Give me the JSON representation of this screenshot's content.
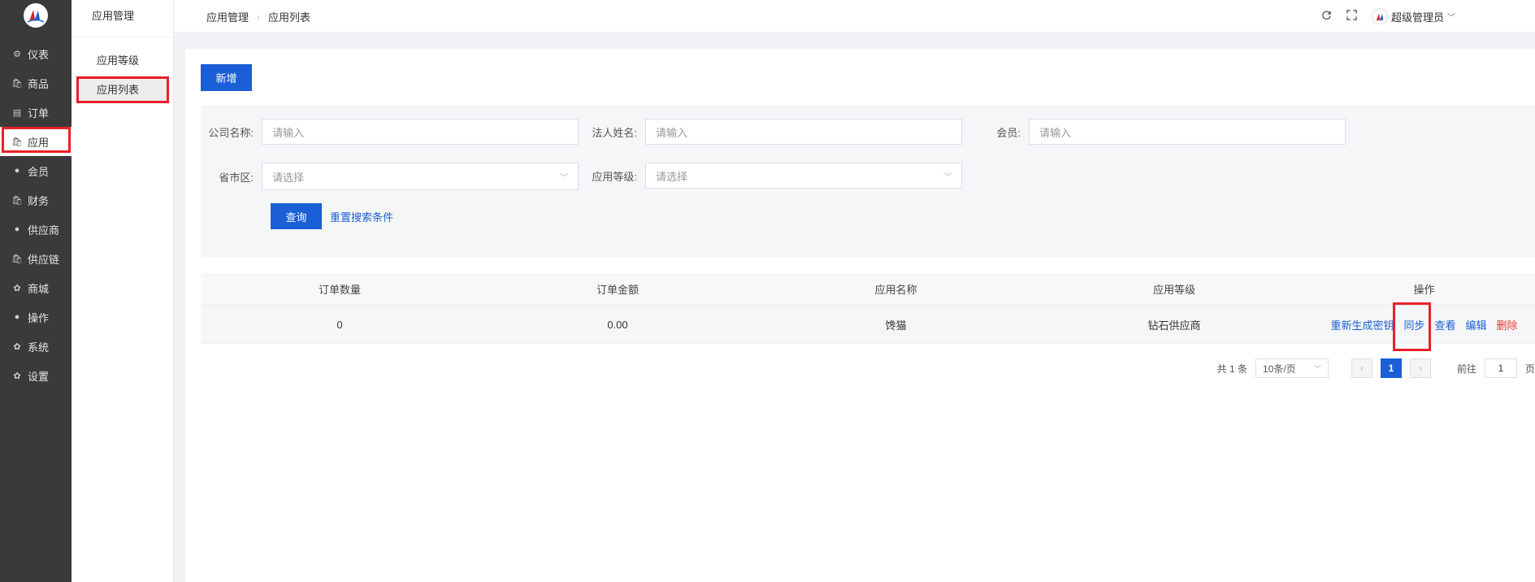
{
  "nav": {
    "items": [
      {
        "label": "仪表",
        "icon": "gauge-icon"
      },
      {
        "label": "商品",
        "icon": "bag-icon"
      },
      {
        "label": "订单",
        "icon": "clipboard-icon"
      },
      {
        "label": "应用",
        "icon": "bag-icon",
        "active": true
      },
      {
        "label": "会员",
        "icon": "user-icon"
      },
      {
        "label": "财务",
        "icon": "bag-icon"
      },
      {
        "label": "供应商",
        "icon": "user-icon"
      },
      {
        "label": "供应链",
        "icon": "bag-icon"
      },
      {
        "label": "商城",
        "icon": "gear-icon"
      },
      {
        "label": "操作",
        "icon": "user-icon"
      },
      {
        "label": "系统",
        "icon": "gear-icon"
      },
      {
        "label": "设置",
        "icon": "gear-icon"
      }
    ]
  },
  "subnav": {
    "title": "应用管理",
    "items": [
      {
        "label": "应用等级"
      },
      {
        "label": "应用列表",
        "active": true
      }
    ]
  },
  "header": {
    "breadcrumb": [
      "应用管理",
      "应用列表"
    ],
    "user_name": "超级管理员"
  },
  "toolbar": {
    "add_label": "新增"
  },
  "filter": {
    "company_label": "公司名称:",
    "company_placeholder": "请输入",
    "legal_label": "法人姓名:",
    "legal_placeholder": "请输入",
    "member_label": "会员:",
    "member_placeholder": "请输入",
    "region_label": "省市区:",
    "region_placeholder": "请选择",
    "level_label": "应用等级:",
    "level_placeholder": "请选择",
    "query_label": "查询",
    "reset_label": "重置搜索条件"
  },
  "table": {
    "columns": [
      "订单数量",
      "订单金额",
      "应用名称",
      "应用等级",
      "操作"
    ],
    "rows": [
      {
        "orders": "0",
        "amount": "0.00",
        "name": "馋猫",
        "level": "钻石供应商"
      }
    ],
    "actions": [
      "重新生成密钥",
      "同步",
      "查看",
      "编辑",
      "删除"
    ]
  },
  "pagination": {
    "total": "共 1 条",
    "page_size": "10条/页",
    "current": "1",
    "goto_label": "前往",
    "goto_value": "1",
    "page_suffix": "页"
  },
  "colors": {
    "primary": "#1a5fd6",
    "danger": "#e53935",
    "nav_bg": "#3a3a3a",
    "highlight": "#e8202a"
  }
}
